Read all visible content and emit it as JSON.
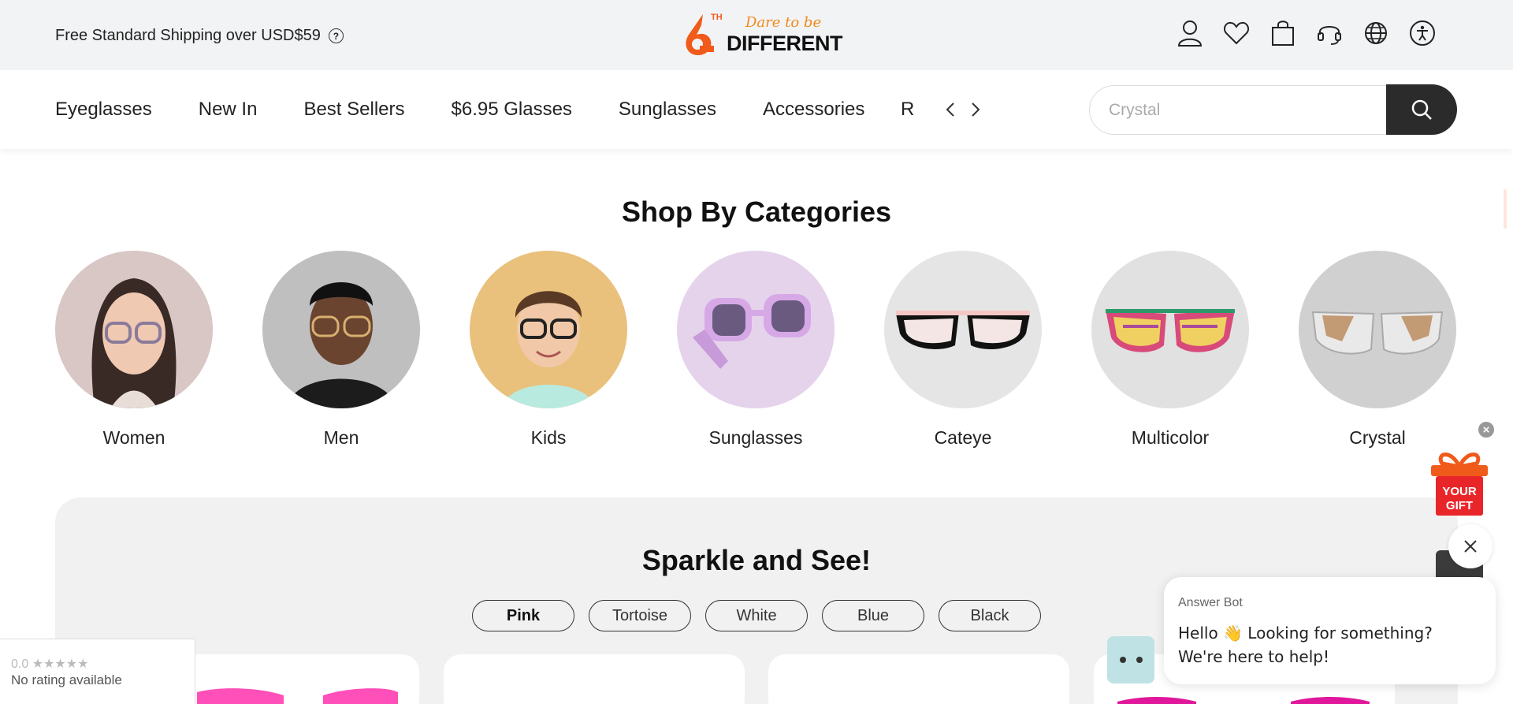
{
  "topbar": {
    "shipping_text": "Free Standard Shipping over USD$59",
    "help_icon": "question-circle-icon",
    "icons": [
      "user-icon",
      "heart-icon",
      "bag-icon",
      "headset-icon",
      "globe-icon",
      "accessibility-icon"
    ]
  },
  "logo": {
    "six": "6",
    "superscript": "TH",
    "script": "Dare to be",
    "brand": "DIFFERENT",
    "colors": {
      "orange": "#f05a1a",
      "accent": "#f08a1a"
    }
  },
  "nav": {
    "items": [
      "Eyeglasses",
      "New In",
      "Best Sellers",
      "$6.95 Glasses",
      "Sunglasses",
      "Accessories"
    ],
    "overflow_item": "R",
    "prev_icon": "chevron-left-icon",
    "next_icon": "chevron-right-icon"
  },
  "search": {
    "placeholder": "Crystal",
    "button_icon": "search-icon"
  },
  "categories": {
    "title": "Shop By Categories",
    "items": [
      {
        "label": "Women",
        "bg": "#d8c7c5"
      },
      {
        "label": "Men",
        "bg": "#bfbfbf"
      },
      {
        "label": "Kids",
        "bg": "#e9c17c"
      },
      {
        "label": "Sunglasses",
        "bg": "#e5d3ec"
      },
      {
        "label": "Cateye",
        "bg": "#e5e5e5"
      },
      {
        "label": "Multicolor",
        "bg": "#e1e1e1"
      },
      {
        "label": "Crystal",
        "bg": "#d0d0d0"
      }
    ]
  },
  "sparkle": {
    "title": "Sparkle and See!",
    "chips": [
      "Pink",
      "Tortoise",
      "White",
      "Blue",
      "Black"
    ],
    "active_chip": "Pink"
  },
  "rating": {
    "score": "0.0",
    "stars": "★★★★★",
    "text": "No rating available"
  },
  "gift": {
    "line1": "YOUR",
    "line2": "GIFT",
    "close": "×"
  },
  "chat": {
    "sender": "Answer Bot",
    "message": "Hello 👋 Looking for something? We're here to help!",
    "close_icon": "close-icon"
  }
}
